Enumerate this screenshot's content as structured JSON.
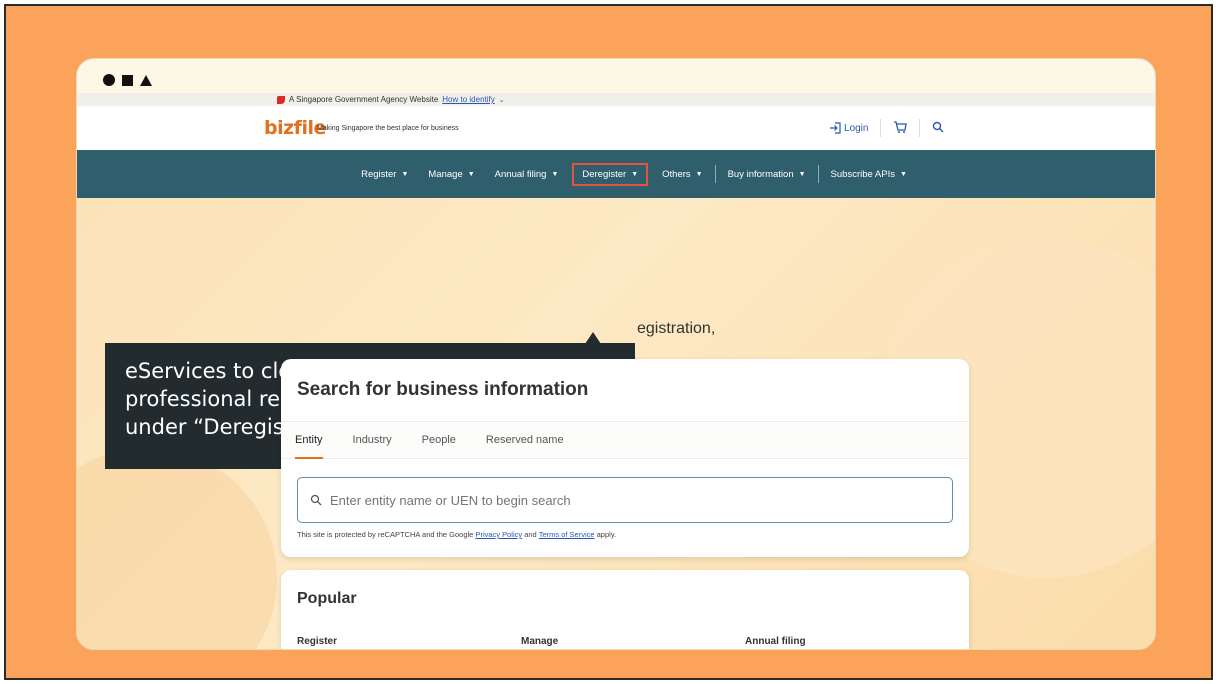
{
  "gov_banner": {
    "text": "A Singapore Government Agency Website",
    "link": "How to identify"
  },
  "header": {
    "logo": "bizfile",
    "tagline": "Making Singapore the best place for business",
    "login": "Login"
  },
  "nav": {
    "items": [
      {
        "label": "Register"
      },
      {
        "label": "Manage"
      },
      {
        "label": "Annual filing"
      },
      {
        "label": "Deregister"
      },
      {
        "label": "Others"
      },
      {
        "label": "Buy information"
      },
      {
        "label": "Subscribe APIs"
      }
    ]
  },
  "callout": {
    "line1": "eServices to close an entity or cancel",
    "line2": "professional registration can be accessed",
    "line3": "under “Deregister”."
  },
  "hero": {
    "subtext_fragment": "egistration,"
  },
  "search": {
    "title": "Search for business information",
    "tabs": [
      "Entity",
      "Industry",
      "People",
      "Reserved name"
    ],
    "active_tab": "Entity",
    "placeholder": "Enter entity name or UEN to begin search",
    "recaptcha_prefix": "This site is protected by reCAPTCHA and the Google",
    "privacy_link": "Privacy Policy",
    "and_text": "and",
    "terms_link": "Terms of Service",
    "apply_text": "apply."
  },
  "popular": {
    "title": "Popular",
    "columns": [
      "Register",
      "Manage",
      "Annual filing"
    ]
  },
  "colors": {
    "frame_bg": "#fba35a",
    "nav_bg": "#2f5e6d",
    "brand_orange": "#e2701f",
    "callout_bg": "#222b2e",
    "active_outline": "#e0553f"
  }
}
